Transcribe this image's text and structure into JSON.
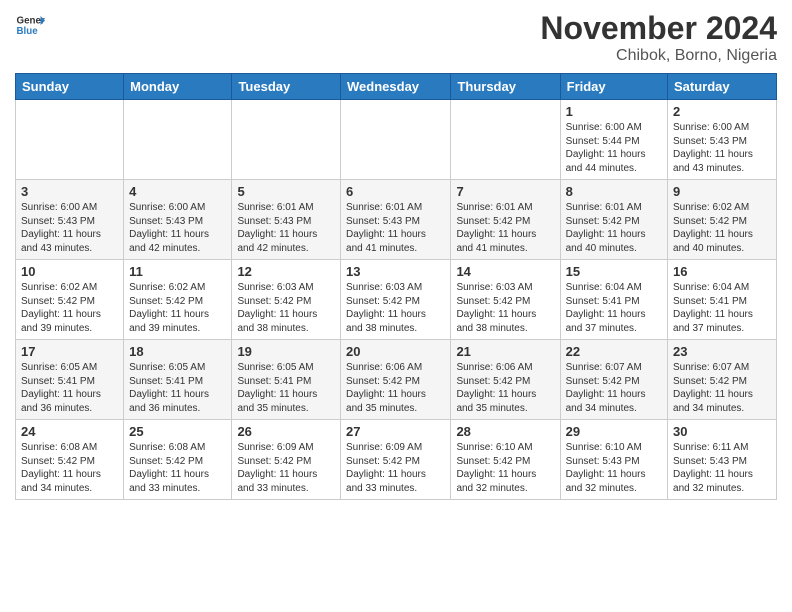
{
  "logo": {
    "line1": "General",
    "line2": "Blue"
  },
  "header": {
    "month": "November 2024",
    "location": "Chibok, Borno, Nigeria"
  },
  "weekdays": [
    "Sunday",
    "Monday",
    "Tuesday",
    "Wednesday",
    "Thursday",
    "Friday",
    "Saturday"
  ],
  "weeks": [
    [
      {
        "day": "",
        "info": ""
      },
      {
        "day": "",
        "info": ""
      },
      {
        "day": "",
        "info": ""
      },
      {
        "day": "",
        "info": ""
      },
      {
        "day": "",
        "info": ""
      },
      {
        "day": "1",
        "info": "Sunrise: 6:00 AM\nSunset: 5:44 PM\nDaylight: 11 hours\nand 44 minutes."
      },
      {
        "day": "2",
        "info": "Sunrise: 6:00 AM\nSunset: 5:43 PM\nDaylight: 11 hours\nand 43 minutes."
      }
    ],
    [
      {
        "day": "3",
        "info": "Sunrise: 6:00 AM\nSunset: 5:43 PM\nDaylight: 11 hours\nand 43 minutes."
      },
      {
        "day": "4",
        "info": "Sunrise: 6:00 AM\nSunset: 5:43 PM\nDaylight: 11 hours\nand 42 minutes."
      },
      {
        "day": "5",
        "info": "Sunrise: 6:01 AM\nSunset: 5:43 PM\nDaylight: 11 hours\nand 42 minutes."
      },
      {
        "day": "6",
        "info": "Sunrise: 6:01 AM\nSunset: 5:43 PM\nDaylight: 11 hours\nand 41 minutes."
      },
      {
        "day": "7",
        "info": "Sunrise: 6:01 AM\nSunset: 5:42 PM\nDaylight: 11 hours\nand 41 minutes."
      },
      {
        "day": "8",
        "info": "Sunrise: 6:01 AM\nSunset: 5:42 PM\nDaylight: 11 hours\nand 40 minutes."
      },
      {
        "day": "9",
        "info": "Sunrise: 6:02 AM\nSunset: 5:42 PM\nDaylight: 11 hours\nand 40 minutes."
      }
    ],
    [
      {
        "day": "10",
        "info": "Sunrise: 6:02 AM\nSunset: 5:42 PM\nDaylight: 11 hours\nand 39 minutes."
      },
      {
        "day": "11",
        "info": "Sunrise: 6:02 AM\nSunset: 5:42 PM\nDaylight: 11 hours\nand 39 minutes."
      },
      {
        "day": "12",
        "info": "Sunrise: 6:03 AM\nSunset: 5:42 PM\nDaylight: 11 hours\nand 38 minutes."
      },
      {
        "day": "13",
        "info": "Sunrise: 6:03 AM\nSunset: 5:42 PM\nDaylight: 11 hours\nand 38 minutes."
      },
      {
        "day": "14",
        "info": "Sunrise: 6:03 AM\nSunset: 5:42 PM\nDaylight: 11 hours\nand 38 minutes."
      },
      {
        "day": "15",
        "info": "Sunrise: 6:04 AM\nSunset: 5:41 PM\nDaylight: 11 hours\nand 37 minutes."
      },
      {
        "day": "16",
        "info": "Sunrise: 6:04 AM\nSunset: 5:41 PM\nDaylight: 11 hours\nand 37 minutes."
      }
    ],
    [
      {
        "day": "17",
        "info": "Sunrise: 6:05 AM\nSunset: 5:41 PM\nDaylight: 11 hours\nand 36 minutes."
      },
      {
        "day": "18",
        "info": "Sunrise: 6:05 AM\nSunset: 5:41 PM\nDaylight: 11 hours\nand 36 minutes."
      },
      {
        "day": "19",
        "info": "Sunrise: 6:05 AM\nSunset: 5:41 PM\nDaylight: 11 hours\nand 35 minutes."
      },
      {
        "day": "20",
        "info": "Sunrise: 6:06 AM\nSunset: 5:42 PM\nDaylight: 11 hours\nand 35 minutes."
      },
      {
        "day": "21",
        "info": "Sunrise: 6:06 AM\nSunset: 5:42 PM\nDaylight: 11 hours\nand 35 minutes."
      },
      {
        "day": "22",
        "info": "Sunrise: 6:07 AM\nSunset: 5:42 PM\nDaylight: 11 hours\nand 34 minutes."
      },
      {
        "day": "23",
        "info": "Sunrise: 6:07 AM\nSunset: 5:42 PM\nDaylight: 11 hours\nand 34 minutes."
      }
    ],
    [
      {
        "day": "24",
        "info": "Sunrise: 6:08 AM\nSunset: 5:42 PM\nDaylight: 11 hours\nand 34 minutes."
      },
      {
        "day": "25",
        "info": "Sunrise: 6:08 AM\nSunset: 5:42 PM\nDaylight: 11 hours\nand 33 minutes."
      },
      {
        "day": "26",
        "info": "Sunrise: 6:09 AM\nSunset: 5:42 PM\nDaylight: 11 hours\nand 33 minutes."
      },
      {
        "day": "27",
        "info": "Sunrise: 6:09 AM\nSunset: 5:42 PM\nDaylight: 11 hours\nand 33 minutes."
      },
      {
        "day": "28",
        "info": "Sunrise: 6:10 AM\nSunset: 5:42 PM\nDaylight: 11 hours\nand 32 minutes."
      },
      {
        "day": "29",
        "info": "Sunrise: 6:10 AM\nSunset: 5:43 PM\nDaylight: 11 hours\nand 32 minutes."
      },
      {
        "day": "30",
        "info": "Sunrise: 6:11 AM\nSunset: 5:43 PM\nDaylight: 11 hours\nand 32 minutes."
      }
    ]
  ]
}
